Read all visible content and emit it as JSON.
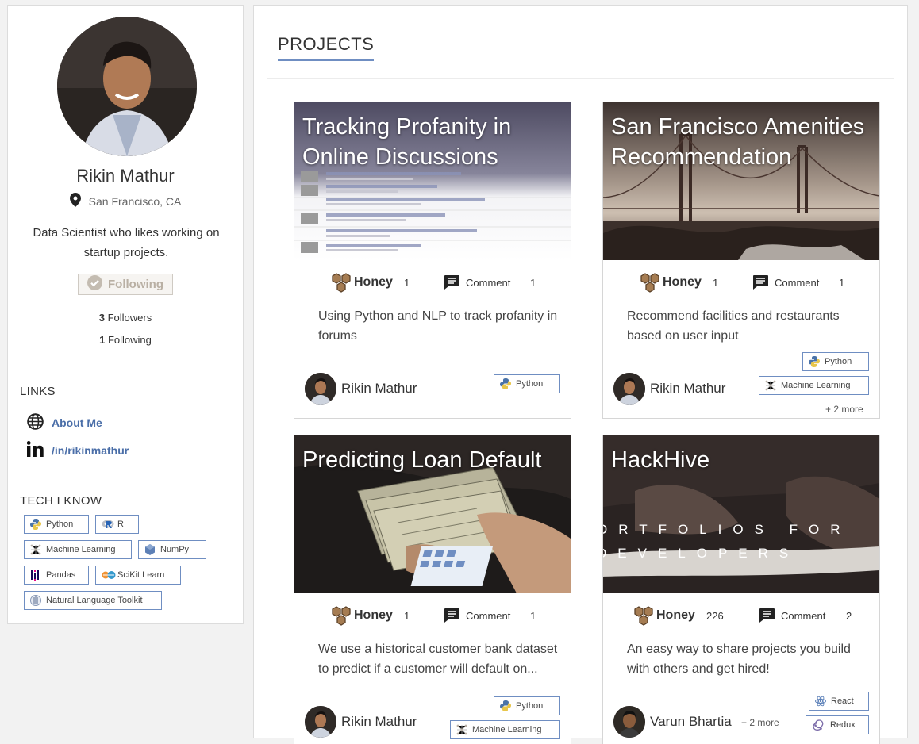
{
  "profile": {
    "name": "Rikin Mathur",
    "location": "San Francisco, CA",
    "bio": "Data Scientist who likes working on startup projects.",
    "follow_button": "Following",
    "followers_count": "3",
    "followers_label": "Followers",
    "following_count": "1",
    "following_label": "Following"
  },
  "links": {
    "heading": "LINKS",
    "items": [
      {
        "label": "About Me",
        "icon": "globe-icon"
      },
      {
        "label": "/in/rikinmathur",
        "icon": "linkedin-icon"
      }
    ]
  },
  "tech": {
    "heading": "TECH I KNOW",
    "items": [
      "Python",
      "R",
      "Machine Learning",
      "NumPy",
      "Pandas",
      "SciKit Learn",
      "Natural Language Toolkit"
    ]
  },
  "projects_heading": "PROJECTS",
  "cards": [
    {
      "title": "Tracking Profanity in Online Discussions",
      "honey_label": "Honey",
      "honey_count": "1",
      "comment_label": "Comment",
      "comment_count": "1",
      "description": "Using Python and NLP to track profanity in forums",
      "author": "Rikin Mathur",
      "tags": [
        "Python"
      ]
    },
    {
      "title": "San Francisco Amenities Recommendation",
      "honey_label": "Honey",
      "honey_count": "1",
      "comment_label": "Comment",
      "comment_count": "1",
      "description": "Recommend facilities and restaurants based on user input",
      "author": "Rikin Mathur",
      "tags": [
        "Python",
        "Machine Learning"
      ],
      "more": "+ 2 more"
    },
    {
      "title": "Predicting Loan Default",
      "honey_label": "Honey",
      "honey_count": "1",
      "comment_label": "Comment",
      "comment_count": "1",
      "description": "We use a historical customer bank dataset to predict if a customer will default on...",
      "author": "Rikin Mathur",
      "tags": [
        "Python",
        "Machine Learning"
      ]
    },
    {
      "title": "HackHive",
      "image_text_1": "ORTFOLIOS  FOR",
      "image_text_2": "DEVELOPERS",
      "honey_label": "Honey",
      "honey_count": "226",
      "comment_label": "Comment",
      "comment_count": "2",
      "description": "An easy way to share projects you build with others and get hired!",
      "author": "Varun Bhartia",
      "more": "+ 2 more",
      "tags": [
        "React",
        "Redux"
      ]
    }
  ],
  "colors": {
    "accent": "#6f8ec2",
    "link": "#4a6ea8",
    "honey": "#8b6a45"
  }
}
